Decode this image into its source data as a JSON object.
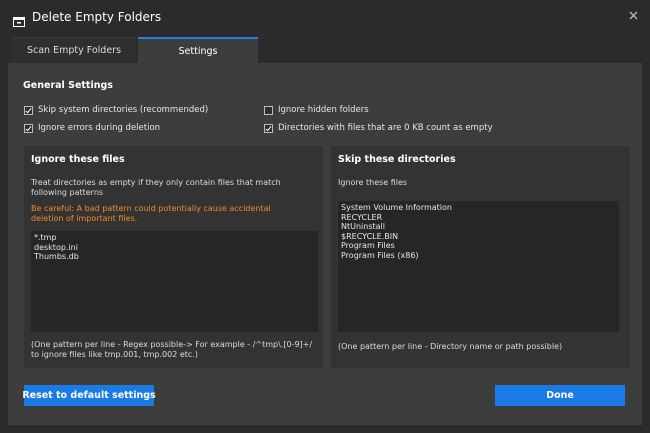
{
  "window": {
    "title": "Delete Empty Folders",
    "close_icon": "close-icon",
    "app_icon": "folder-icon"
  },
  "tabs": [
    {
      "label": "Scan Empty Folders",
      "active": false
    },
    {
      "label": "Settings",
      "active": true
    }
  ],
  "general": {
    "title": "General Settings",
    "options": [
      {
        "label": "Skip system directories (recommended)",
        "checked": true
      },
      {
        "label": "Ignore errors during deletion",
        "checked": true
      },
      {
        "label": "Ignore hidden folders",
        "checked": false
      },
      {
        "label": "Directories with files that are 0 KB count as empty",
        "checked": true
      }
    ]
  },
  "ignore_files": {
    "title": "Ignore these files",
    "description": "Treat directories as empty if they only contain files that match following patterns",
    "warning": "Be careful: A bad pattern could potentially cause accidental deletion of important files.",
    "patterns": [
      "*.tmp",
      "desktop.ini",
      "Thumbs.db"
    ],
    "hint": "(One pattern per line - Regex possible-> For example - /^tmp\\.[0-9]+/ to ignore files like tmp.001, tmp.002 etc.)"
  },
  "skip_dirs": {
    "title": "Skip these directories",
    "description": "Ignore these files",
    "directories": [
      "System Volume Information",
      "RECYCLER",
      "NtUninstall",
      "$RECYCLE.BIN",
      "Program Files",
      "Program Files (x86)"
    ],
    "hint": "(One pattern per line - Directory name or path possible)"
  },
  "buttons": {
    "reset_label": "Reset to default settings",
    "done_label": "Done"
  },
  "colors": {
    "accent": "#1b7be6",
    "warning": "#f0892a",
    "background": "#2b2b2b",
    "panel": "#3d3d3d"
  }
}
